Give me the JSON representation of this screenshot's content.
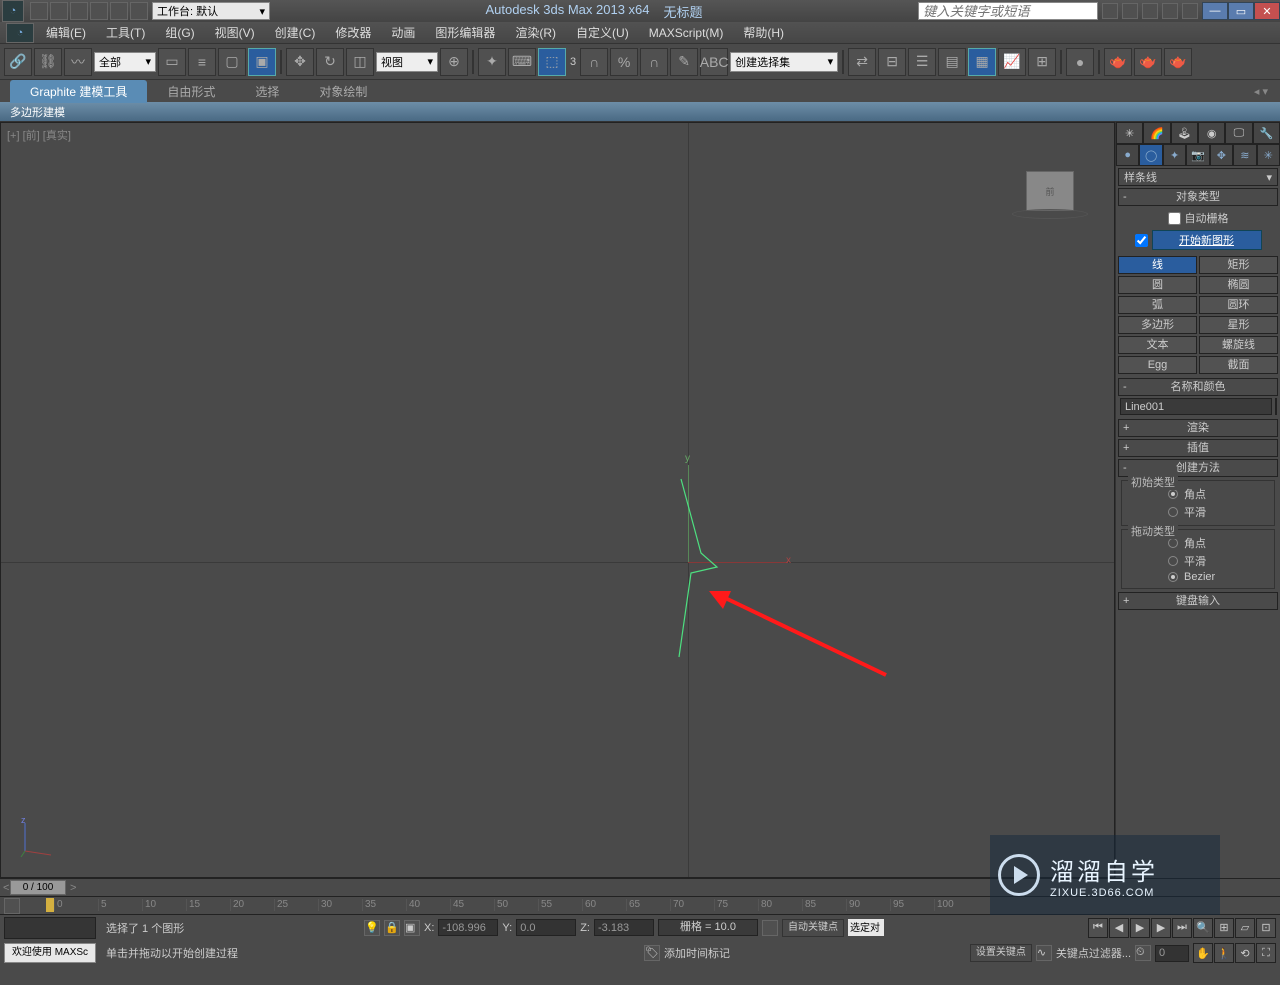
{
  "title": {
    "app": "Autodesk 3ds Max  2013 x64",
    "doc": "无标题"
  },
  "workspace_label": "工作台: 默认",
  "search_placeholder": "键入关键字或短语",
  "menu": [
    "编辑(E)",
    "工具(T)",
    "组(G)",
    "视图(V)",
    "创建(C)",
    "修改器",
    "动画",
    "图形编辑器",
    "渲染(R)",
    "自定义(U)",
    "MAXScript(M)",
    "帮助(H)"
  ],
  "toolbar": {
    "filter_dd": "全部",
    "view_dd": "视图",
    "named_set_dd": "创建选择集",
    "angle_label": "3"
  },
  "ribbon": {
    "tabs": [
      "Graphite 建模工具",
      "自由形式",
      "选择",
      "对象绘制"
    ],
    "sub": "多边形建模"
  },
  "viewport": {
    "label": "[+] [前] [真实]",
    "axis_x": "x",
    "axis_y": "y",
    "mini_z": "z",
    "cube": "前"
  },
  "panel": {
    "category": "样条线",
    "rollouts": {
      "obj_type": "对象类型",
      "auto_grid": "自动栅格",
      "start_new": "开始新图形",
      "name_color": "名称和颜色",
      "render": "渲染",
      "interp": "插值",
      "create_method": "创建方法",
      "kb": "键盘输入"
    },
    "buttons": {
      "line": "线",
      "rect": "矩形",
      "circle": "圆",
      "ellipse": "椭圆",
      "arc": "弧",
      "donut": "圆环",
      "ngon": "多边形",
      "star": "星形",
      "text": "文本",
      "helix": "螺旋线",
      "egg": "Egg",
      "section": "截面"
    },
    "object_name": "Line001",
    "method": {
      "init_group": "初始类型",
      "drag_group": "拖动类型",
      "corner": "角点",
      "smooth": "平滑",
      "bezier": "Bezier"
    }
  },
  "timeline": {
    "slider": "0 / 100"
  },
  "ruler": {
    "ticks": [
      0,
      5,
      10,
      15,
      20,
      25,
      30,
      35,
      40,
      45,
      50,
      55,
      60,
      65,
      70,
      75,
      80,
      85,
      90,
      95,
      100
    ]
  },
  "status": {
    "welcome": "欢迎使用  MAXSc",
    "line1": "选择了 1 个图形",
    "line2": "单击并拖动以开始创建过程",
    "x_lbl": "X:",
    "x_val": "-108.996",
    "y_lbl": "Y:",
    "y_val": "0.0",
    "z_lbl": "Z:",
    "z_val": "-3.183",
    "grid": "栅格 = 10.0",
    "auto_key": "自动关键点",
    "set_key": "设置关键点",
    "sel_box": "选定对",
    "key_filter": "关键点过滤器...",
    "add_tag": "添加时间标记",
    "spinner": "0"
  }
}
